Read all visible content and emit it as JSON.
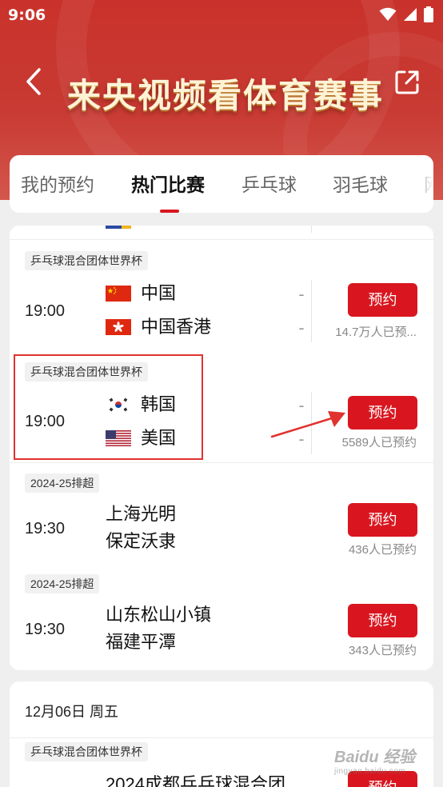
{
  "status_bar": {
    "time": "9:06"
  },
  "banner": {
    "title": "来央视频看体育赛事"
  },
  "tabs": [
    {
      "label": "我的预约"
    },
    {
      "label": "热门比赛",
      "active": true
    },
    {
      "label": "乒乓球"
    },
    {
      "label": "羽毛球"
    },
    {
      "label": "网"
    }
  ],
  "matches": [
    {
      "league": "乒乓球混合团体世界杯",
      "time": "19:00",
      "team_a": "中国",
      "team_a_flag": "china-flag-icon",
      "team_b": "中国香港",
      "team_b_flag": "hong-kong-flag-icon",
      "score_a": "-",
      "score_b": "-",
      "button": "预约",
      "reservations": "14.7万人已预..."
    },
    {
      "league": "乒乓球混合团体世界杯",
      "time": "19:00",
      "team_a": "韩国",
      "team_a_flag": "south-korea-flag-icon",
      "team_b": "美国",
      "team_b_flag": "usa-flag-icon",
      "score_a": "-",
      "score_b": "-",
      "button": "预约",
      "reservations": "5589人已预约"
    },
    {
      "league": "2024-25排超",
      "time": "19:30",
      "team_a": "上海光明",
      "team_b": "保定沃隶",
      "button": "预约",
      "reservations": "436人已预约"
    },
    {
      "league": "2024-25排超",
      "time": "19:30",
      "team_a": "山东松山小镇",
      "team_b": "福建平潭",
      "button": "预约",
      "reservations": "343人已预约"
    }
  ],
  "next_day": {
    "date": "12月06日 周五",
    "league": "乒乓球混合团体世界杯",
    "title": "2024成都乒乓球混合团",
    "button": "预约"
  },
  "watermark": {
    "brand": "Baidu 经验",
    "url": "jingyan.baidu.com"
  },
  "colors": {
    "brand_red": "#d9161f",
    "banner_red": "#c9322b",
    "annotation_red": "#e0322f"
  }
}
